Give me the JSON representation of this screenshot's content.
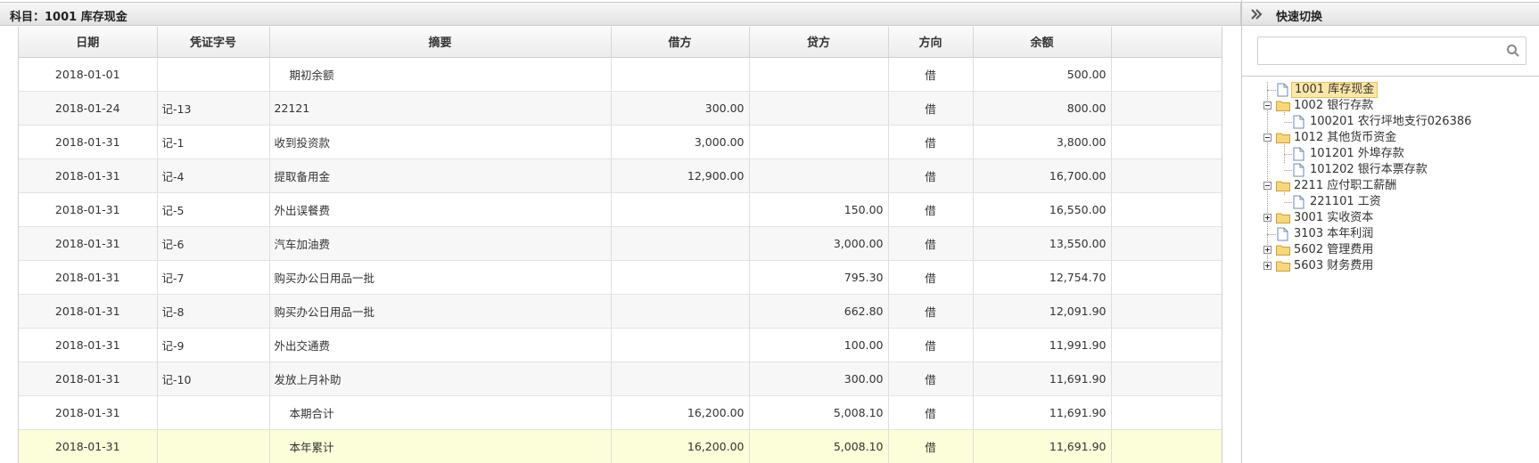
{
  "ledger": {
    "subject_label": "科目：1001 库存现金",
    "columns": [
      "日期",
      "凭证字号",
      "摘要",
      "借方",
      "贷方",
      "方向",
      "余额"
    ],
    "rows": [
      {
        "date": "2018-01-01",
        "voucher": "",
        "summary": "期初余额",
        "debit": "",
        "credit": "",
        "direction": "借",
        "balance": "500.00"
      },
      {
        "date": "2018-01-24",
        "voucher": "记-13",
        "summary": "22121",
        "debit": "300.00",
        "credit": "",
        "direction": "借",
        "balance": "800.00"
      },
      {
        "date": "2018-01-31",
        "voucher": "记-1",
        "summary": "收到投资款",
        "debit": "3,000.00",
        "credit": "",
        "direction": "借",
        "balance": "3,800.00"
      },
      {
        "date": "2018-01-31",
        "voucher": "记-4",
        "summary": "提取备用金",
        "debit": "12,900.00",
        "credit": "",
        "direction": "借",
        "balance": "16,700.00"
      },
      {
        "date": "2018-01-31",
        "voucher": "记-5",
        "summary": "外出误餐费",
        "debit": "",
        "credit": "150.00",
        "direction": "借",
        "balance": "16,550.00"
      },
      {
        "date": "2018-01-31",
        "voucher": "记-6",
        "summary": "汽车加油费",
        "debit": "",
        "credit": "3,000.00",
        "direction": "借",
        "balance": "13,550.00"
      },
      {
        "date": "2018-01-31",
        "voucher": "记-7",
        "summary": "购买办公日用品一批",
        "debit": "",
        "credit": "795.30",
        "direction": "借",
        "balance": "12,754.70"
      },
      {
        "date": "2018-01-31",
        "voucher": "记-8",
        "summary": "购买办公日用品一批",
        "debit": "",
        "credit": "662.80",
        "direction": "借",
        "balance": "12,091.90"
      },
      {
        "date": "2018-01-31",
        "voucher": "记-9",
        "summary": "外出交通费",
        "debit": "",
        "credit": "100.00",
        "direction": "借",
        "balance": "11,991.90"
      },
      {
        "date": "2018-01-31",
        "voucher": "记-10",
        "summary": "发放上月补助",
        "debit": "",
        "credit": "300.00",
        "direction": "借",
        "balance": "11,691.90"
      },
      {
        "date": "2018-01-31",
        "voucher": "",
        "summary": "本期合计",
        "debit": "16,200.00",
        "credit": "5,008.10",
        "direction": "借",
        "balance": "11,691.90"
      },
      {
        "date": "2018-01-31",
        "voucher": "",
        "summary": "本年累计",
        "debit": "16,200.00",
        "credit": "5,008.10",
        "direction": "借",
        "balance": "11,691.90"
      }
    ]
  },
  "quick_switch": {
    "title": "快速切换",
    "collapse_icon": "double-chevron-right-icon",
    "search_placeholder": "",
    "search_icon": "search-icon",
    "tree": [
      {
        "label": "1001 库存现金",
        "type": "file",
        "selected": true
      },
      {
        "label": "1002 银行存款",
        "type": "folder",
        "state": "expanded"
      },
      {
        "label": "100201 农行坪地支行026386",
        "type": "file"
      },
      {
        "label": "1012 其他货币资金",
        "type": "folder",
        "state": "expanded"
      },
      {
        "label": "101201 外埠存款",
        "type": "file"
      },
      {
        "label": "101202 银行本票存款",
        "type": "file"
      },
      {
        "label": "2211 应付职工薪酬",
        "type": "folder",
        "state": "expanded"
      },
      {
        "label": "221101 工资",
        "type": "file"
      },
      {
        "label": "3001 实收资本",
        "type": "folder",
        "state": "collapsed"
      },
      {
        "label": "3103 本年利润",
        "type": "file"
      },
      {
        "label": "5602 管理费用",
        "type": "folder",
        "state": "collapsed"
      },
      {
        "label": "5603 财务费用",
        "type": "folder",
        "state": "collapsed"
      }
    ]
  }
}
